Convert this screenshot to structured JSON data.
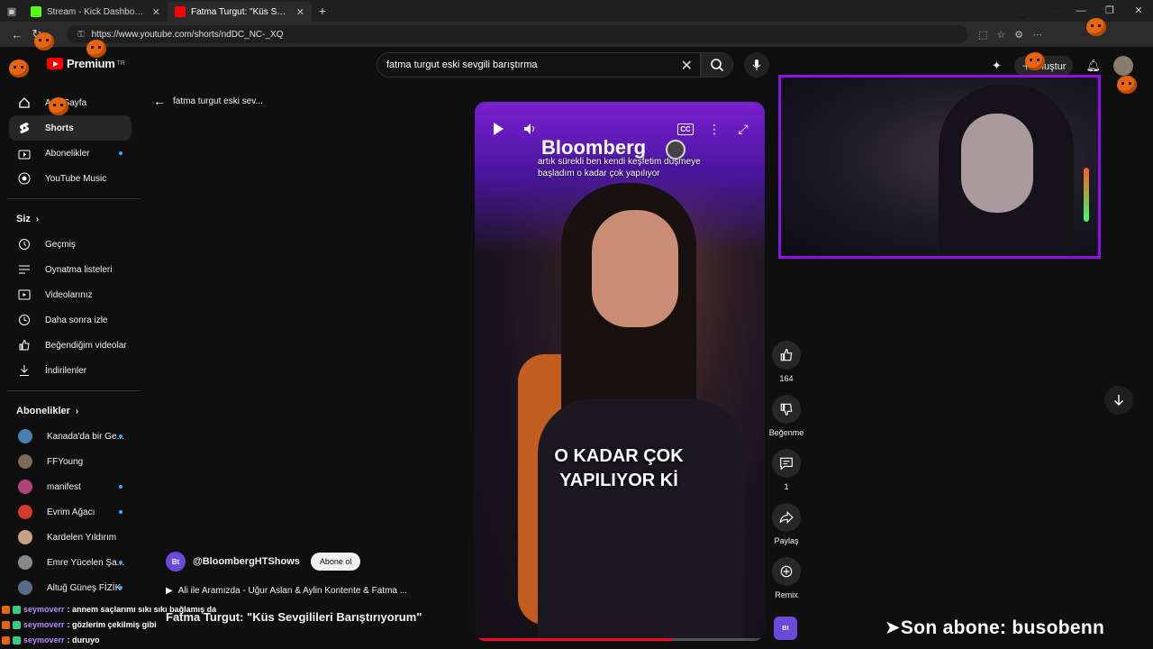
{
  "browser": {
    "tabs": [
      {
        "title": "Stream - Kick Dashboard",
        "favicon_color": "#53fc18",
        "active": false
      },
      {
        "title": "Fatma Turgut: \"Küs Sevgilileri Barış",
        "favicon_color": "#ff0000",
        "active": true
      }
    ],
    "new_tab": "+",
    "url": "https://www.youtube.com/shorts/ndDC_NC-_XQ"
  },
  "header": {
    "logo_text": "Premium",
    "logo_sup": "TR",
    "search_value": "fatma turgut eski sevgili barıştırma",
    "create_label": "Oluştur"
  },
  "sidebar": {
    "main": [
      {
        "label": "Ana Sayfa",
        "icon": "home-icon"
      },
      {
        "label": "Shorts",
        "icon": "shorts-icon",
        "active": true
      },
      {
        "label": "Abonelikler",
        "icon": "subscriptions-icon",
        "dot": true
      },
      {
        "label": "YouTube Music",
        "icon": "music-icon"
      }
    ],
    "you_header": "Siz",
    "you": [
      {
        "label": "Geçmiş",
        "icon": "history-icon"
      },
      {
        "label": "Oynatma listeleri",
        "icon": "playlist-icon"
      },
      {
        "label": "Videolarınız",
        "icon": "your-videos-icon"
      },
      {
        "label": "Daha sonra izle",
        "icon": "watch-later-icon"
      },
      {
        "label": "Beğendiğim videolar",
        "icon": "liked-icon"
      },
      {
        "label": "İndirilenler",
        "icon": "download-icon"
      }
    ],
    "subs_header": "Abonelikler",
    "subs": [
      {
        "label": "Kanada'da bir Ge...",
        "color": "#4a7fb0",
        "dot": true
      },
      {
        "label": "FFYoung",
        "color": "#7a6a5a",
        "dot": false
      },
      {
        "label": "manifest",
        "color": "#b0447a",
        "dot": true
      },
      {
        "label": "Evrim Ağacı",
        "color": "#d33a2c",
        "dot": true
      },
      {
        "label": "Kardelen Yıldırım",
        "color": "#c9a080",
        "dot": false
      },
      {
        "label": "Emre Yücelen Şa...",
        "color": "#888888",
        "dot": true
      },
      {
        "label": "Altuğ Güneş FİZİK",
        "color": "#5a6a8a",
        "dot": true
      }
    ]
  },
  "shorts": {
    "back_query": "fatma turgut eski sev...",
    "brand": "Bloomberg",
    "caption_top": "artık sürekli ben kendi keşfetim düşmeye başladım o kadar çok yapılıyor",
    "caption_big": "O KADAR ÇOK YAPILIYOR Kİ",
    "channel": "@BloombergHTShows",
    "channel_badge": "Bt",
    "subscribe_label": "Abone ol",
    "related": "Ali ile Aramızda - Uğur Aslan & Aylin Kontente & Fatma ...",
    "title": "Fatma Turgut: \"Küs Sevgilileri Barıştırıyorum\"",
    "cc_label": "CC",
    "progress": 0.68
  },
  "actions": {
    "like_count": "164",
    "dislike_label": "Beğenme",
    "comment_count": "1",
    "share_label": "Paylaş",
    "remix_label": "Remix",
    "remix_badge": "Bt"
  },
  "stream_overlay": {
    "chat": [
      {
        "user": "seymoverr",
        "message": ": annem saçlarımı sıkı sıkı bağlamış da"
      },
      {
        "user": "seymoverr",
        "message": ": gözlerim çekilmiş gibi"
      },
      {
        "user": "seymoverr",
        "message": ": duruyo"
      }
    ],
    "last_sub": "➤Son abone: busobenn",
    "webcam_border": "#8f10e6"
  }
}
